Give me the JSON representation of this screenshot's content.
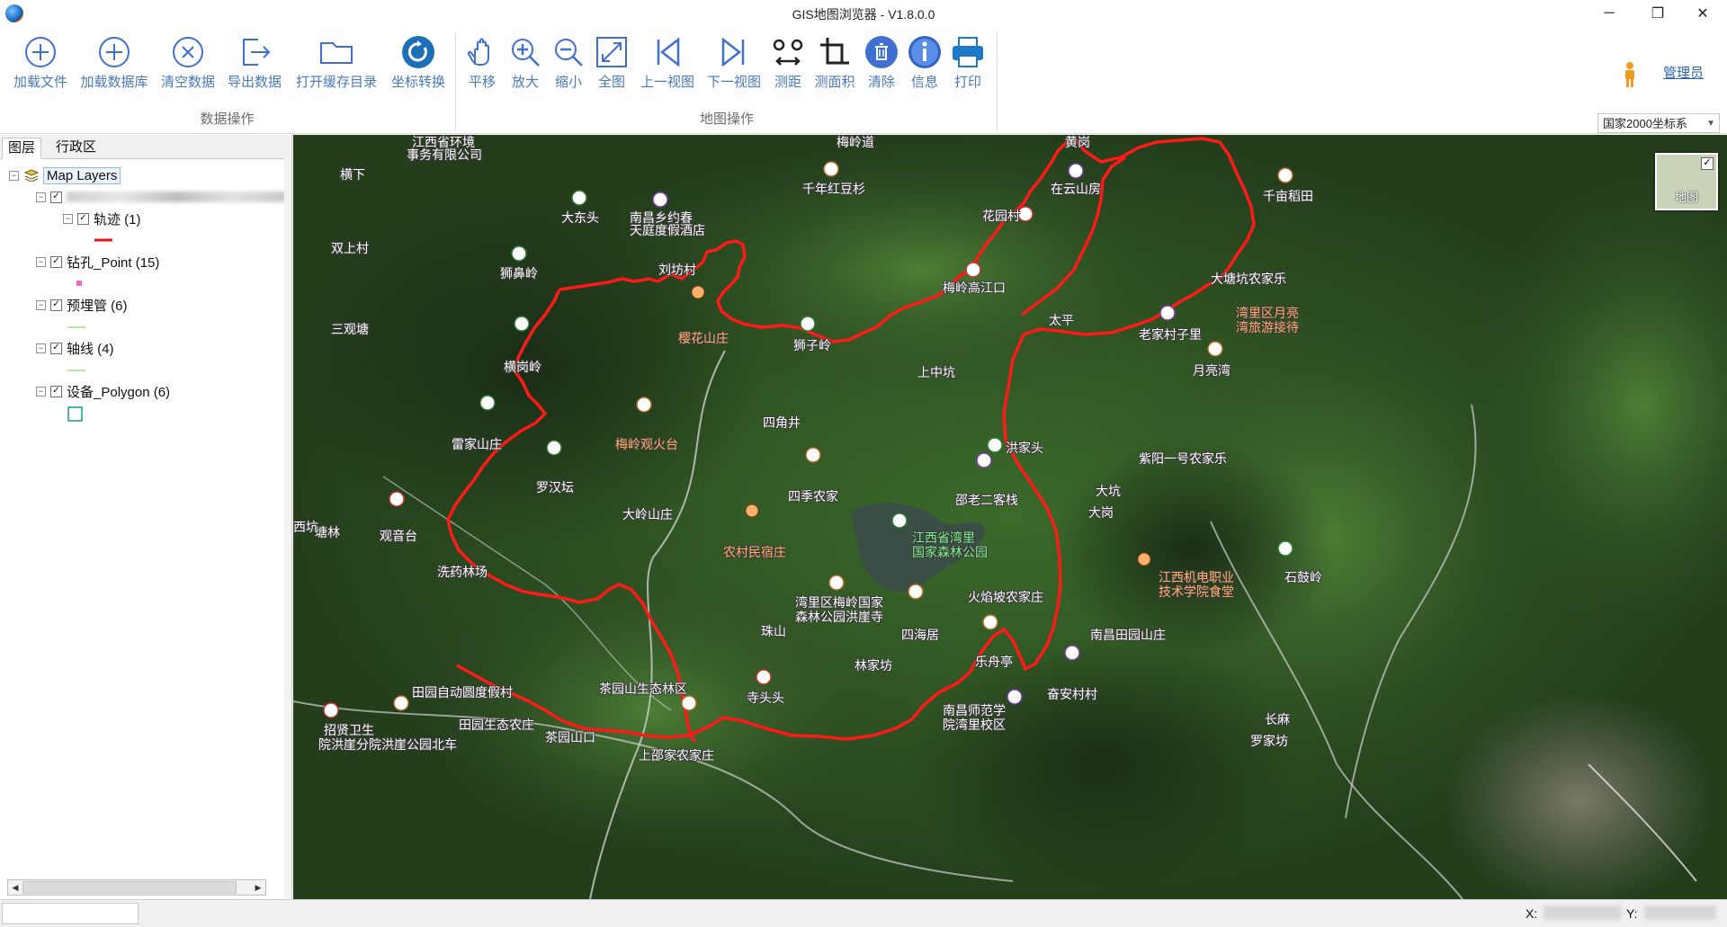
{
  "window": {
    "title": "GIS地图浏览器 - V1.8.0.0",
    "minimize_glyph": "─",
    "restore_glyph": "❐",
    "close_glyph": "✕"
  },
  "ribbon": {
    "data_group": {
      "label": "数据操作",
      "buttons": [
        {
          "label": "加载文件",
          "icon": "add-circle-icon"
        },
        {
          "label": "加载数据库",
          "icon": "add-circle-icon"
        },
        {
          "label": "清空数据",
          "icon": "clear-circle-icon"
        },
        {
          "label": "导出数据",
          "icon": "export-icon"
        },
        {
          "label": "打开缓存目录",
          "icon": "folder-icon"
        },
        {
          "label": "坐标转换",
          "icon": "refresh-icon"
        }
      ]
    },
    "map_group": {
      "label": "地图操作",
      "buttons": [
        {
          "label": "平移",
          "icon": "hand-icon"
        },
        {
          "label": "放大",
          "icon": "zoom-in-icon"
        },
        {
          "label": "缩小",
          "icon": "zoom-out-icon"
        },
        {
          "label": "全图",
          "icon": "full-extent-icon"
        },
        {
          "label": "上一视图",
          "icon": "previous-view-icon"
        },
        {
          "label": "下一视图",
          "icon": "next-view-icon"
        },
        {
          "label": "测距",
          "icon": "measure-distance-icon"
        },
        {
          "label": "测面积",
          "icon": "measure-area-icon"
        },
        {
          "label": "清除",
          "icon": "trash-icon"
        },
        {
          "label": "信息",
          "icon": "info-icon"
        },
        {
          "label": "打印",
          "icon": "print-icon"
        }
      ]
    },
    "user": "管理员",
    "coordinate_system": "国家2000坐标系"
  },
  "left_panel": {
    "tabs": [
      "图层",
      "行政区"
    ],
    "tree": {
      "root": "Map Layers",
      "layers": [
        {
          "name": "轨迹 (1)",
          "checked": true,
          "legend": "red-line"
        },
        {
          "name": "钻孔_Point (15)",
          "checked": true,
          "legend": "pink-point"
        },
        {
          "name": "预埋管 (6)",
          "checked": true,
          "legend": "light-green-line"
        },
        {
          "name": "轴线 (4)",
          "checked": true,
          "legend": "light-green-line"
        },
        {
          "name": "设备_Polygon (6)",
          "checked": true,
          "legend": "teal-square"
        }
      ]
    }
  },
  "map": {
    "basemap_switch_label": "地图",
    "track_color": "#ff1a1a",
    "labels": [
      {
        "text": "江西省环境",
        "kind": "white"
      },
      {
        "text": "事务有限公司",
        "kind": "white"
      },
      {
        "text": "梅岭道",
        "kind": "white"
      },
      {
        "text": "黄岗",
        "kind": "white"
      },
      {
        "text": "千年红豆杉",
        "kind": "white"
      },
      {
        "text": "在云山房",
        "kind": "white"
      },
      {
        "text": "千亩稻田",
        "kind": "white"
      },
      {
        "text": "大东头",
        "kind": "white"
      },
      {
        "text": "南昌乡约春",
        "kind": "white"
      },
      {
        "text": "天庭度假酒店",
        "kind": "white"
      },
      {
        "text": "花园村",
        "kind": "white"
      },
      {
        "text": "双上村",
        "kind": "white"
      },
      {
        "text": "狮鼻岭",
        "kind": "white"
      },
      {
        "text": "刘坊村",
        "kind": "white"
      },
      {
        "text": "梅岭高江口",
        "kind": "white"
      },
      {
        "text": "大塘坑农家乐",
        "kind": "white"
      },
      {
        "text": "三观塘",
        "kind": "white"
      },
      {
        "text": "樱花山庄",
        "kind": "orange"
      },
      {
        "text": "狮子岭",
        "kind": "white"
      },
      {
        "text": "湾里区月亮",
        "kind": "orange"
      },
      {
        "text": "湾旅游接待",
        "kind": "orange"
      },
      {
        "text": "太平",
        "kind": "white"
      },
      {
        "text": "老家村子里",
        "kind": "white"
      },
      {
        "text": "横岗岭",
        "kind": "white"
      },
      {
        "text": "上中坑",
        "kind": "white"
      },
      {
        "text": "月亮湾",
        "kind": "white"
      },
      {
        "text": "四角井",
        "kind": "white"
      },
      {
        "text": "梅岭观火台",
        "kind": "orange"
      },
      {
        "text": "雷家山庄",
        "kind": "white"
      },
      {
        "text": "洪家头",
        "kind": "white"
      },
      {
        "text": "紫阳一号农家乐",
        "kind": "white"
      },
      {
        "text": "罗汉坛",
        "kind": "white"
      },
      {
        "text": "四季农家",
        "kind": "white"
      },
      {
        "text": "邵老二客栈",
        "kind": "white"
      },
      {
        "text": "大岭山庄",
        "kind": "white"
      },
      {
        "text": "大岗",
        "kind": "white"
      },
      {
        "text": "观音台",
        "kind": "white"
      },
      {
        "text": "江西省湾里",
        "kind": "green"
      },
      {
        "text": "国家森林公园",
        "kind": "green"
      },
      {
        "text": "农村民宿庄",
        "kind": "orange"
      },
      {
        "text": "洗药林场",
        "kind": "white"
      },
      {
        "text": "湾里区梅岭国家",
        "kind": "white"
      },
      {
        "text": "森林公园洪崖寺",
        "kind": "white"
      },
      {
        "text": "江西机电职业",
        "kind": "orange"
      },
      {
        "text": "技术学院食堂",
        "kind": "orange"
      },
      {
        "text": "石鼓岭",
        "kind": "white"
      },
      {
        "text": "火焰坡农家庄",
        "kind": "white"
      },
      {
        "text": "四海居",
        "kind": "white"
      },
      {
        "text": "南昌田园山庄",
        "kind": "white"
      },
      {
        "text": "珠山",
        "kind": "white"
      },
      {
        "text": "乐舟亭",
        "kind": "white"
      },
      {
        "text": "林家坊",
        "kind": "white"
      },
      {
        "text": "田园自动圆度假村",
        "kind": "white"
      },
      {
        "text": "茶园山生态林区",
        "kind": "white"
      },
      {
        "text": "奋安村村",
        "kind": "white"
      },
      {
        "text": "招贤卫生",
        "kind": "white"
      },
      {
        "text": "院洪崖分院",
        "kind": "white"
      },
      {
        "text": "洪崖公园北车",
        "kind": "white"
      },
      {
        "text": "田园生态农庄",
        "kind": "white"
      },
      {
        "text": "茶园山口",
        "kind": "white"
      },
      {
        "text": "寺头头",
        "kind": "white"
      },
      {
        "text": "南昌师范学",
        "kind": "white"
      },
      {
        "text": "院湾里校区",
        "kind": "white"
      },
      {
        "text": "上邵家农家庄",
        "kind": "white"
      },
      {
        "text": "罗家坊",
        "kind": "white"
      },
      {
        "text": "长麻",
        "kind": "white"
      },
      {
        "text": "大坑",
        "kind": "white"
      },
      {
        "text": "塘林",
        "kind": "white"
      },
      {
        "text": "西坑",
        "kind": "white"
      },
      {
        "text": "横下",
        "kind": "white"
      }
    ]
  },
  "status": {
    "x_label": "X:",
    "y_label": "Y:"
  }
}
